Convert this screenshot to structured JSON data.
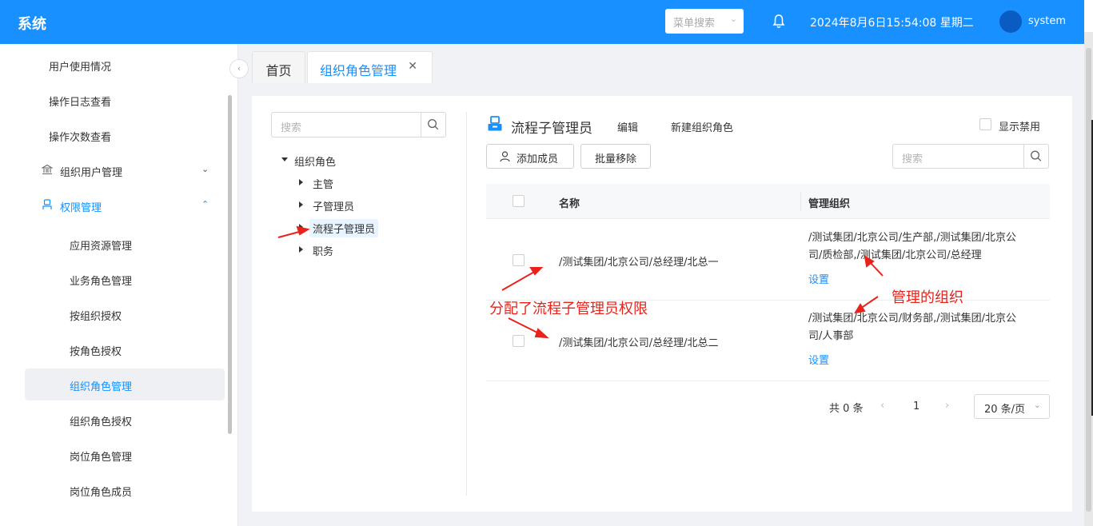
{
  "header": {
    "app_title": "系统",
    "menu_search_placeholder": "菜单搜索",
    "datetime": "2024年8月6日15:54:08 星期二",
    "username": "system",
    "brand_color": "#1890ff"
  },
  "sidebar": {
    "items": [
      {
        "label": "用户使用情况"
      },
      {
        "label": "操作日志查看"
      },
      {
        "label": "操作次数查看"
      },
      {
        "label": "组织用户管理",
        "icon": "bank-icon"
      },
      {
        "label": "权限管理",
        "icon": "user-icon"
      },
      {
        "label": "应用资源管理"
      },
      {
        "label": "业务角色管理"
      },
      {
        "label": "按组织授权"
      },
      {
        "label": "按角色授权"
      },
      {
        "label": "组织角色管理"
      },
      {
        "label": "组织角色授权"
      },
      {
        "label": "岗位角色管理"
      },
      {
        "label": "岗位角色成员"
      }
    ]
  },
  "tabs": [
    {
      "label": "首页"
    },
    {
      "label": "组织角色管理"
    }
  ],
  "tree": {
    "search_placeholder": "搜索",
    "root": "组织角色",
    "children": [
      "主管",
      "子管理员",
      "流程子管理员",
      "职务"
    ]
  },
  "role": {
    "title": "流程子管理员",
    "edit_label": "编辑",
    "new_label": "新建组织角色",
    "show_disabled_label": "显示禁用",
    "add_member_label": "添加成员",
    "batch_remove_label": "批量移除",
    "search_placeholder": "搜索"
  },
  "table": {
    "columns": [
      "名称",
      "管理组织"
    ],
    "rows": [
      {
        "name": "/测试集团/北京公司/总经理/北总一",
        "org_line1": "/测试集团/北京公司/生产部,/测试集团/北京公",
        "org_line2": "司/质检部,/测试集团/北京公司/总经理",
        "action": "设置"
      },
      {
        "name": "/测试集团/北京公司/总经理/北总二",
        "org_line1": "/测试集团/北京公司/财务部,/测试集团/北京公",
        "org_line2": "司/人事部",
        "action": "设置"
      }
    ]
  },
  "pagination": {
    "total_label": "共 0 条",
    "page": "1",
    "page_size": "20 条/页"
  },
  "annotations": {
    "assigned": "分配了流程子管理员权限",
    "managed_org": "管理的组织",
    "color": "#e8231b"
  }
}
